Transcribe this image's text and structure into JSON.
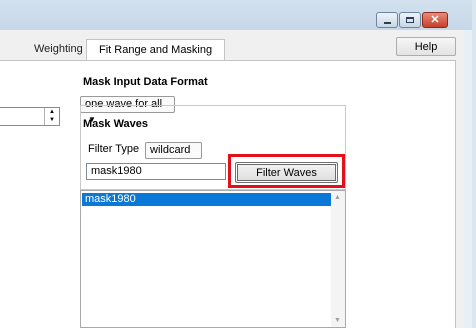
{
  "window": {
    "caption_buttons": [
      "minimize-icon",
      "maximize-icon",
      "close-icon"
    ],
    "close_glyph": "✕"
  },
  "toolbar": {
    "help_label": "Help"
  },
  "tabs": [
    {
      "label": "Weighting",
      "active": false
    },
    {
      "label": "Fit Range and Masking",
      "active": true
    }
  ],
  "mask_input": {
    "heading": "Mask Input Data Format",
    "format_value": "one wave for all"
  },
  "mask_waves": {
    "heading": "Mask Waves",
    "filter_type_label": "Filter Type",
    "filter_type_value": "wildcard",
    "filter_text": "mask1980",
    "filter_button_label": "Filter Waves",
    "list_items": [
      {
        "label": "mask1980",
        "selected": true
      }
    ]
  },
  "colors": {
    "highlight": "#e3101b",
    "selection": "#0a78d7"
  }
}
